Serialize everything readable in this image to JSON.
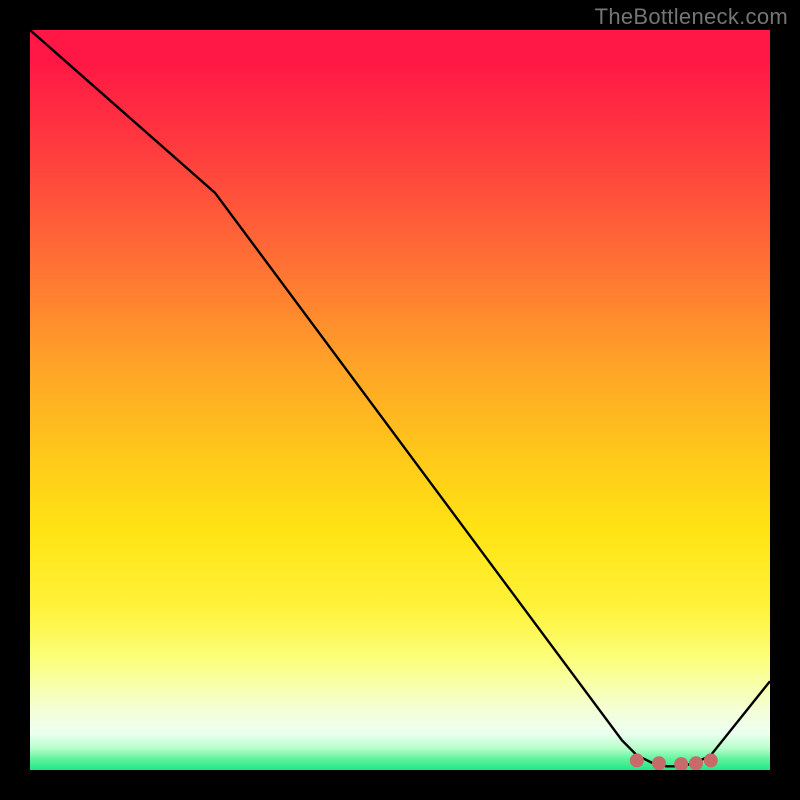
{
  "watermark": "TheBottleneck.com",
  "chart_data": {
    "type": "line",
    "title": "",
    "xlabel": "",
    "ylabel": "",
    "xlim": [
      0,
      100
    ],
    "ylim": [
      0,
      100
    ],
    "series": [
      {
        "name": "bottleneck-curve",
        "x": [
          0,
          25,
          80,
          82,
          84,
          86,
          88,
          90,
          92,
          100
        ],
        "values": [
          100,
          78,
          4,
          2,
          1,
          0.5,
          0.5,
          1,
          2,
          12
        ]
      }
    ],
    "markers": {
      "name": "optimal-zone",
      "x": [
        82,
        85,
        88,
        90,
        92
      ],
      "values": [
        1.3,
        0.9,
        0.8,
        0.9,
        1.3
      ]
    },
    "gradient_bands": [
      {
        "pos": 0.0,
        "color": "#ff1745"
      },
      {
        "pos": 0.45,
        "color": "#ffa228"
      },
      {
        "pos": 0.7,
        "color": "#ffe414"
      },
      {
        "pos": 0.9,
        "color": "#f7ffb0"
      },
      {
        "pos": 1.0,
        "color": "#1fe887"
      }
    ]
  }
}
